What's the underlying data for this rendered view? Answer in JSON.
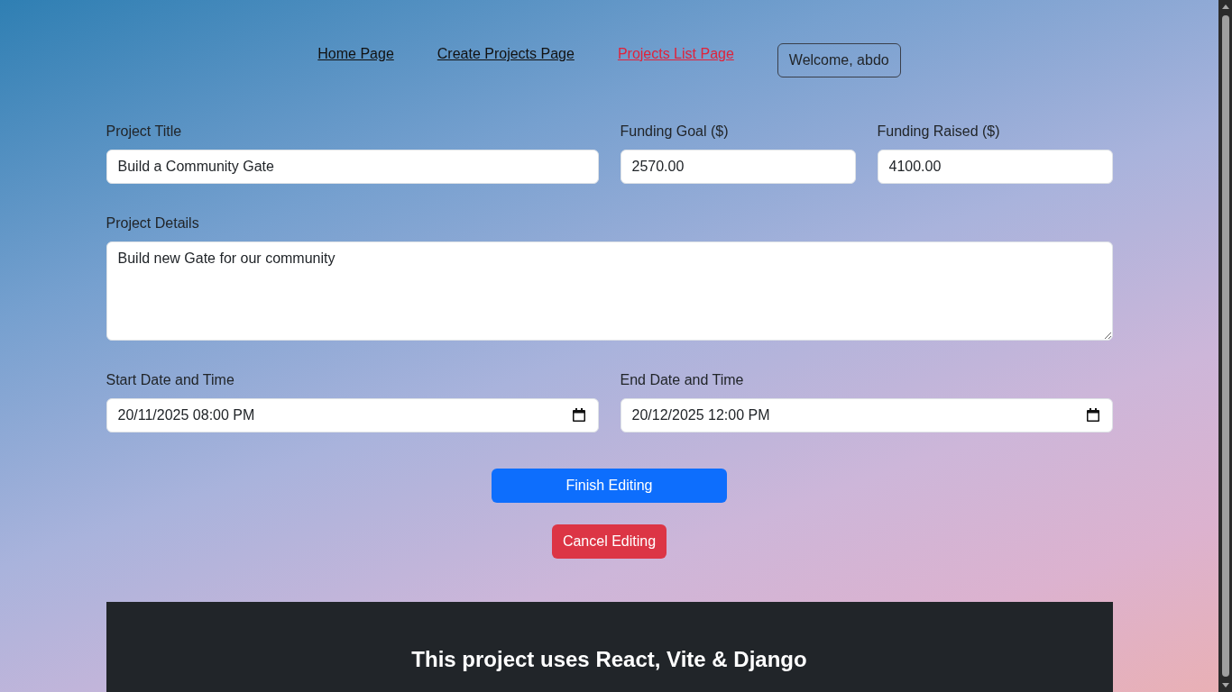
{
  "nav": {
    "links": [
      {
        "label": "Home Page",
        "selected": false
      },
      {
        "label": "Create Projects Page",
        "selected": false
      },
      {
        "label": "Projects List Page",
        "selected": true
      }
    ],
    "user_button": "Welcome, abdo"
  },
  "form": {
    "rows": [
      [
        {
          "label": "Project Title",
          "kind": "input",
          "value": "Build a Community Gate"
        },
        {
          "label": "Funding Goal ($)",
          "kind": "input",
          "value": "2570.00"
        },
        {
          "label": "Funding Raised ($)",
          "kind": "input",
          "value": "4100.00"
        }
      ],
      [
        {
          "label": "Project Details",
          "kind": "textarea",
          "value": "Build new Gate for our community"
        }
      ],
      [
        {
          "label": "Start Date and Time",
          "kind": "datetime",
          "value": "20/11/2025 08:00 PM"
        },
        {
          "label": "End Date and Time",
          "kind": "datetime",
          "value": "20/12/2025 12:00 PM"
        }
      ]
    ]
  },
  "buttons": [
    {
      "label": "Finish Editing",
      "kind": "primary"
    },
    {
      "label": "Cancel Editing",
      "kind": "danger"
    }
  ],
  "footer": {
    "text": "This project uses React, Vite & Django"
  }
}
